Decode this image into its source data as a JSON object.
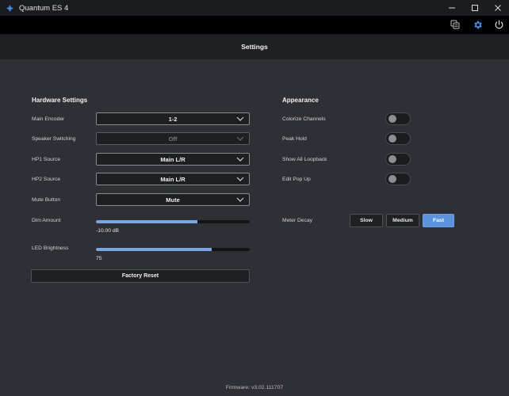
{
  "window": {
    "title": "Quantum ES 4",
    "minimize_glyph": "—",
    "maximize_glyph": "☐",
    "close_glyph": "✕"
  },
  "toolbar": {
    "icons": [
      "copy-icon",
      "gear-icon",
      "power-icon"
    ],
    "active_color": "#4a90e2"
  },
  "header": {
    "title": "Settings"
  },
  "hardware": {
    "title": "Hardware Settings",
    "main_encoder": {
      "label": "Main Encoder",
      "value": "1-2"
    },
    "speaker_switching": {
      "label": "Speaker Switching",
      "value": "Off"
    },
    "hp1_source": {
      "label": "HP1 Source",
      "value": "Main L/R"
    },
    "hp2_source": {
      "label": "HP2 Source",
      "value": "Main L/R"
    },
    "mute_button": {
      "label": "Mute Button",
      "value": "Mute"
    },
    "dim_amount": {
      "label": "Dim Amount",
      "value_text": "-10.00 dB",
      "fill_fraction": 0.66
    },
    "led_brightness": {
      "label": "LED Brightness",
      "value_text": "75",
      "fill_fraction": 0.75
    },
    "factory_reset_label": "Factory Reset"
  },
  "appearance": {
    "title": "Appearance",
    "colorize_channels": {
      "label": "Colorize Channels",
      "on": false
    },
    "peak_hold": {
      "label": "Peak Hold",
      "on": false
    },
    "show_all_loopback": {
      "label": "Show All Loopback",
      "on": false
    },
    "edit_pop_up": {
      "label": "Edit Pop Up",
      "on": false
    },
    "meter_decay": {
      "label": "Meter Decay",
      "options": [
        "Slow",
        "Medium",
        "Fast"
      ],
      "selected": "Fast"
    }
  },
  "footer": {
    "firmware": "Firmware: v3.02.111707"
  },
  "colors": {
    "background": "#2f3035",
    "accent": "#5b93de",
    "slider_fill": "#7aa6e6"
  }
}
